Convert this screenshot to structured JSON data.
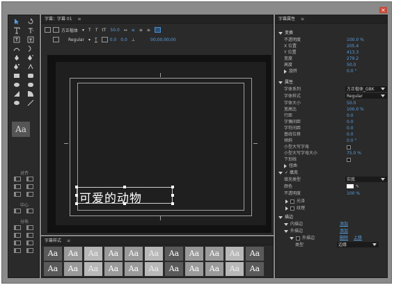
{
  "window": {
    "close": "×"
  },
  "tools": {
    "aa_preview": "Aa",
    "align_label": "对齐",
    "center_label": "中心",
    "distribute_label": "分布"
  },
  "center": {
    "tab_title": "字幕：字幕 01",
    "menu": "≡",
    "font_family": "方正楷体",
    "font_style": "Regular",
    "size_value": "50.0",
    "kerning_value": "0.0",
    "leading_value": "0.0",
    "timecode": "00;00;00;00",
    "caption_text": "可爱的动物"
  },
  "styles_panel": {
    "title": "字幕样式",
    "menu": "≡",
    "swatches": [
      "Aa",
      "Aa",
      "Aa",
      "Aa",
      "Aa",
      "Aa",
      "Aa",
      "Aa",
      "Aa",
      "Aa",
      "Aa",
      "Aa",
      "Aa",
      "Aa",
      "Aa",
      "Aa",
      "Aa",
      "Aa",
      "Aa",
      "Aa",
      "Aa",
      "Aa"
    ]
  },
  "props": {
    "title": "字幕属性",
    "menu": "≡",
    "transform": {
      "header": "变换",
      "opacity": {
        "label": "不透明度",
        "value": "100.0 %"
      },
      "x": {
        "label": "X 位置",
        "value": "205.4"
      },
      "y": {
        "label": "Y 位置",
        "value": "413.3"
      },
      "width": {
        "label": "宽度",
        "value": "279.2"
      },
      "height": {
        "label": "高度",
        "value": "50.0"
      },
      "rotation": {
        "label": "旋转",
        "value": "0.0 °"
      }
    },
    "attributes": {
      "header": "属性",
      "font_family": {
        "label": "字体系列",
        "value": "方正楷体_GBK"
      },
      "font_style": {
        "label": "字体样式",
        "value": "Regular"
      },
      "font_size": {
        "label": "字体大小",
        "value": "50.0"
      },
      "aspect": {
        "label": "宽高比",
        "value": "100.0 %"
      },
      "leading": {
        "label": "行距",
        "value": "0.0"
      },
      "kerning": {
        "label": "字偶间距",
        "value": "0.0"
      },
      "tracking": {
        "label": "字符间距",
        "value": "0.0"
      },
      "baseline": {
        "label": "基线位移",
        "value": "0.0"
      },
      "slant": {
        "label": "倾斜",
        "value": "0.0 °"
      },
      "small_caps": {
        "label": "小型大写字母"
      },
      "small_caps_size": {
        "label": "小型大写字母大小",
        "value": "75.0 %"
      },
      "underline": {
        "label": "下划线"
      },
      "distort": {
        "label": "扭曲"
      }
    },
    "fill": {
      "header": "填充",
      "fill_type": {
        "label": "填充类型",
        "value": "实底"
      },
      "color": {
        "label": "颜色"
      },
      "opacity": {
        "label": "不透明度",
        "value": "100 %"
      },
      "sheen": {
        "label": "光泽"
      },
      "texture": {
        "label": "纹理"
      }
    },
    "stroke": {
      "header": "描边",
      "inner": {
        "label": "内描边",
        "action": "添加"
      },
      "outer": {
        "label": "外描边",
        "action": "添加"
      },
      "outer_item": {
        "label": "外描边",
        "delete": "删除",
        "up": "上移"
      },
      "type": {
        "label": "类型",
        "value": "边缘"
      }
    }
  },
  "colors": {
    "accent": "#5aa0e0",
    "panel": "#2a2a2a",
    "window": "#8a8a8a"
  }
}
